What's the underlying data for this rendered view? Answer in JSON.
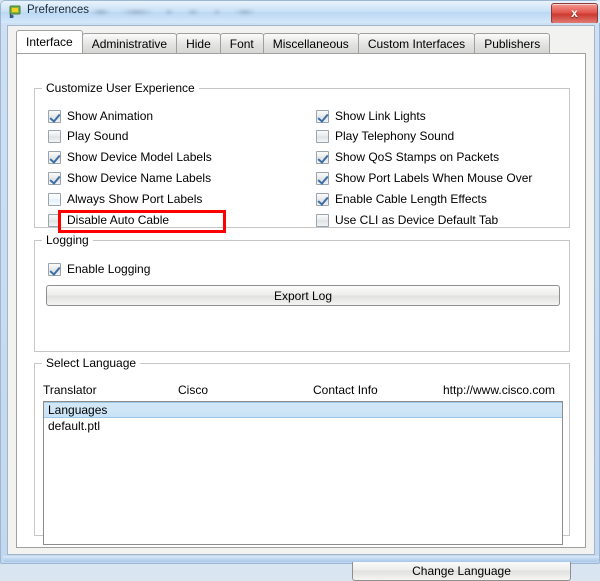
{
  "window": {
    "title": "Preferences",
    "title_icon": "packet-tracer-flag-icon",
    "close_label": "x",
    "accent_red": "#cc3a30",
    "highlight_color": "#ff0000"
  },
  "tabs": [
    {
      "label": "Interface",
      "active": true
    },
    {
      "label": "Administrative",
      "active": false
    },
    {
      "label": "Hide",
      "active": false
    },
    {
      "label": "Font",
      "active": false
    },
    {
      "label": "Miscellaneous",
      "active": false
    },
    {
      "label": "Custom Interfaces",
      "active": false
    },
    {
      "label": "Publishers",
      "active": false
    }
  ],
  "customize": {
    "title": "Customize User Experience",
    "left_options": [
      {
        "label": "Show Animation",
        "checked": true,
        "focused": false
      },
      {
        "label": "Play Sound",
        "checked": false,
        "focused": false
      },
      {
        "label": "Show Device Model Labels",
        "checked": true,
        "focused": false
      },
      {
        "label": "Show Device Name Labels",
        "checked": true,
        "focused": false
      },
      {
        "label": "Always Show Port Labels",
        "checked": false,
        "focused": true
      },
      {
        "label": "Disable Auto Cable",
        "checked": false,
        "focused": false
      }
    ],
    "right_options": [
      {
        "label": "Show Link Lights",
        "checked": true,
        "focused": false
      },
      {
        "label": "Play Telephony Sound",
        "checked": false,
        "focused": false
      },
      {
        "label": "Show QoS Stamps on Packets",
        "checked": true,
        "focused": false
      },
      {
        "label": "Show Port Labels When Mouse Over",
        "checked": true,
        "focused": false
      },
      {
        "label": "Enable Cable Length Effects",
        "checked": true,
        "focused": false
      },
      {
        "label": "Use CLI as Device Default Tab",
        "checked": false,
        "focused": false
      }
    ]
  },
  "logging": {
    "title": "Logging",
    "enable_label": "Enable Logging",
    "enable_checked": true,
    "export_button": "Export Log"
  },
  "language": {
    "title": "Select Language",
    "headers": {
      "translator": "Translator",
      "vendor": "Cisco",
      "contact": "Contact Info",
      "url": "http://www.cisco.com"
    },
    "sort_indicator": "sort-ascending-arrow-icon",
    "items": [
      {
        "label": "Languages",
        "selected": true
      },
      {
        "label": "default.ptl",
        "selected": false
      }
    ],
    "change_button": "Change Language"
  }
}
